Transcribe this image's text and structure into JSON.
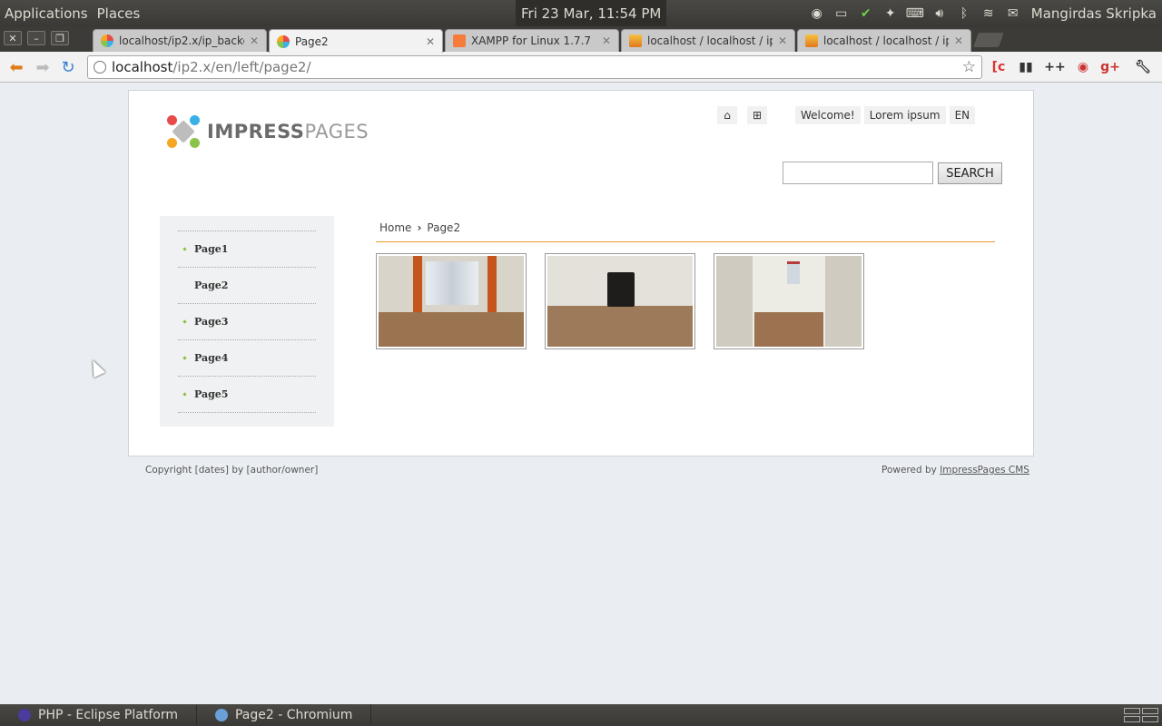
{
  "panel": {
    "menus": [
      "Applications",
      "Places"
    ],
    "clock": "Fri 23 Mar, 11:54 PM",
    "user": "Mangirdas Skripka"
  },
  "tabs": [
    {
      "label": "localhost/ip2.x/ip_backend",
      "favicon": "impresspages",
      "active": false
    },
    {
      "label": "Page2",
      "favicon": "impresspages",
      "active": true
    },
    {
      "label": "XAMPP for Linux 1.7.7",
      "favicon": "xampp",
      "active": false
    },
    {
      "label": "localhost / localhost / ip2.x",
      "favicon": "phpmyadmin",
      "active": false
    },
    {
      "label": "localhost / localhost / ip2.x",
      "favicon": "phpmyadmin",
      "active": false
    }
  ],
  "toolbar": {
    "url_host": "localhost",
    "url_path": "/ip2.x/en/left/page2/"
  },
  "site": {
    "logo_bold": "IMPRESS",
    "logo_light": "PAGES",
    "topnav": {
      "home_icon": "home-icon",
      "sitemap_icon": "sitemap-icon",
      "links": [
        "Welcome!",
        "Lorem ipsum"
      ],
      "language": "EN"
    },
    "search": {
      "placeholder": "",
      "button": "SEARCH"
    },
    "menu": [
      "Page1",
      "Page2",
      "Page3",
      "Page4",
      "Page5"
    ],
    "active_menu": "Page2",
    "breadcrumb": {
      "home": "Home",
      "separator": "›",
      "current": "Page2"
    },
    "gallery_count": 3,
    "footer": {
      "copyright": "Copyright [dates] by [author/owner]",
      "powered_prefix": "Powered by ",
      "powered_link": "ImpressPages CMS"
    }
  },
  "taskbar": {
    "items": [
      "PHP - Eclipse Platform",
      "Page2 - Chromium"
    ]
  },
  "colors": {
    "accent_orange": "#e59a2b",
    "bullet_green": "#8fbf3a",
    "page_bg": "#eaeef2"
  }
}
